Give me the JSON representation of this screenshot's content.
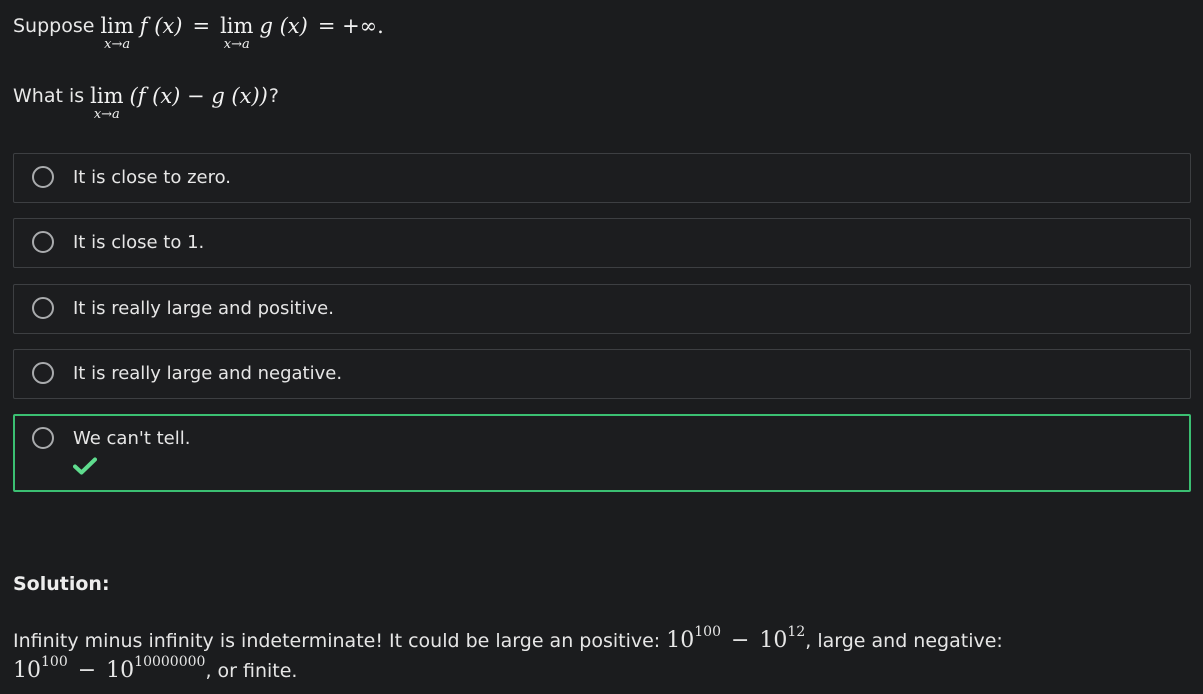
{
  "question": {
    "line1": {
      "prefix": "Suppose",
      "lim_word": "lim",
      "lim_sub": "x→a",
      "f_expr": "f (x)",
      "equals": "=",
      "g_expr": "g (x)",
      "rhs": "= +∞."
    },
    "line2": {
      "prefix": "What is",
      "lim_word": "lim",
      "lim_sub": "x→a",
      "expr": "(f (x) − g (x))",
      "suffix": "?"
    }
  },
  "options": [
    {
      "label": "It is close to zero.",
      "correct": false
    },
    {
      "label": "It is close to 1.",
      "correct": false
    },
    {
      "label": "It is really large and positive.",
      "correct": false
    },
    {
      "label": "It is really large and negative.",
      "correct": false
    },
    {
      "label": "We can't tell.",
      "correct": true
    }
  ],
  "solution": {
    "title": "Solution:",
    "text_a": "Infinity minus infinity is indeterminate! It could be large an positive: ",
    "ex1_base1": "10",
    "ex1_exp1": "100",
    "ex1_minus": "−",
    "ex1_base2": "10",
    "ex1_exp2": "12",
    "text_b": ", large and negative: ",
    "ex2_base1": "10",
    "ex2_exp1": "100",
    "ex2_minus": "−",
    "ex2_base2": "10",
    "ex2_exp2": "10000000",
    "text_c": ", or finite."
  },
  "colors": {
    "background": "#1b1c1e",
    "correct_border": "#3bbf72",
    "check": "#5fdc8e"
  },
  "icons": {
    "radio": "radio-circle-icon",
    "check": "checkmark-icon"
  }
}
